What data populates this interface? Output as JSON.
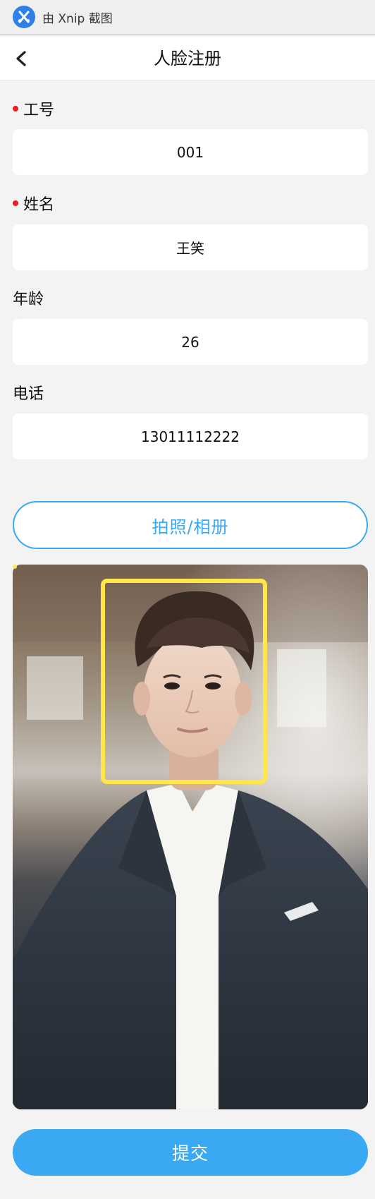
{
  "capture_bar": {
    "label": "由 Xnip 截图"
  },
  "nav": {
    "title": "人脸注册",
    "back_icon": "chevron-left-icon"
  },
  "form": {
    "fields": [
      {
        "label": "工号",
        "value": "001",
        "required": true
      },
      {
        "label": "姓名",
        "value": "王笑",
        "required": true
      },
      {
        "label": "年龄",
        "value": "26",
        "required": false
      },
      {
        "label": "电话",
        "value": "13011112222",
        "required": false
      }
    ]
  },
  "actions": {
    "photo_button": "拍照/相册",
    "submit_button": "提交"
  },
  "colors": {
    "accent": "#3aa8f2",
    "required": "#f01b1b",
    "face_box": "#ffe74a"
  }
}
